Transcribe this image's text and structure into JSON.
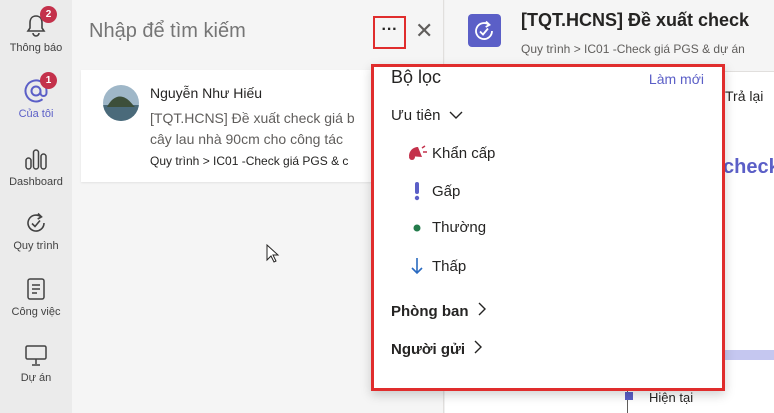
{
  "rail": {
    "items": [
      {
        "label": "Thông báo",
        "badge": "2"
      },
      {
        "label": "Của tôi",
        "badge": "1"
      },
      {
        "label": "Dashboard"
      },
      {
        "label": "Quy trình"
      },
      {
        "label": "Công việc"
      },
      {
        "label": "Dự án"
      }
    ]
  },
  "search": {
    "placeholder": "Nhập để tìm kiếm",
    "more_label": "···",
    "close_label": "✕"
  },
  "card": {
    "name": "Nguyễn Như Hiếu",
    "line1": "[TQT.HCNS] Đề xuất check giá b",
    "line2": "cây lau nhà 90cm cho công tác",
    "path": "Quy trình > IC01 -Check giá PGS & c"
  },
  "detail": {
    "title": "[TQT.HCNS] Đề xuất check",
    "path": "Quy trình  >  IC01 -Check giá PGS & dự án",
    "reply": "Trả lại",
    "big_text": "check",
    "now_label": "Hiện tại"
  },
  "filter": {
    "title": "Bộ lọc",
    "reset": "Làm mới",
    "priority": {
      "label": "Ưu tiên",
      "options": [
        {
          "label": "Khẩn cấp",
          "icon": "urgent-icon",
          "color": "#c4314b"
        },
        {
          "label": "Gấp",
          "icon": "exclamation-icon",
          "color": "#5b5fc7"
        },
        {
          "label": "Thường",
          "icon": "dot-icon",
          "color": "#237b4b"
        },
        {
          "label": "Thấp",
          "icon": "arrow-down-icon",
          "color": "#2a6ac0"
        }
      ]
    },
    "department": {
      "label": "Phòng ban"
    },
    "sender": {
      "label": "Người gửi"
    }
  },
  "colors": {
    "accent": "#5b5fc7",
    "highlight_border": "#e02d2d",
    "badge": "#c4314b"
  }
}
